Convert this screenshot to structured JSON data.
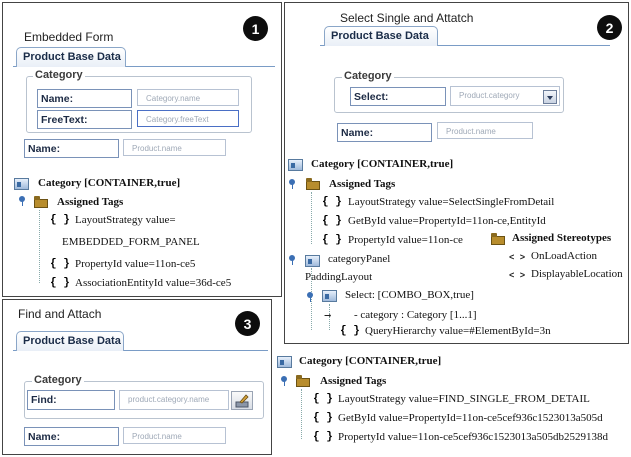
{
  "panels": [
    {
      "number": "1",
      "title": "Embedded Form",
      "tab": "Product Base Data",
      "group_label": "Category",
      "fields": [
        {
          "label": "Name:",
          "placeholder": "Category.name"
        },
        {
          "label": "FreeText:",
          "placeholder": "Category.freeText"
        }
      ],
      "outer_field": {
        "label": "Name:",
        "placeholder": "Product.name"
      },
      "tree": {
        "root": "Category [CONTAINER,true]",
        "tags_label": "Assigned Tags",
        "items": [
          "LayoutStrategy value=",
          "EMBEDDED_FORM_PANEL",
          "PropertyId value=11on-ce5",
          "AssociationEntityId value=36d-ce5"
        ]
      }
    },
    {
      "number": "2",
      "title": "Select Single and Attatch",
      "tab": "Product Base Data",
      "group_label": "Category",
      "fields": [
        {
          "label": "Select:",
          "placeholder": "Product.category"
        }
      ],
      "outer_field": {
        "label": "Name:",
        "placeholder": "Product.name"
      },
      "tree": {
        "root": "Category [CONTAINER,true]",
        "tags_label": "Assigned Tags",
        "items": [
          "LayoutStrategy value=SelectSingleFromDetail",
          "GetById value=PropertyId=11on-ce,EntityId",
          "PropertyId value=11on-ce"
        ],
        "stereotypes_label": "Assigned Stereotypes",
        "stereotypes": [
          "OnLoadAction",
          "DisplayableLocation"
        ],
        "panel_node": "categoryPanel",
        "padding_layout": "PaddingLayout",
        "select_node": "Select: [COMBO_BOX,true]",
        "select_children": [
          "- category : Category [1...1]",
          "QueryHierarchy value=#ElementById=3n"
        ]
      }
    },
    {
      "number": "3",
      "title": "Find and Attach",
      "tab": "Product Base Data",
      "group_label": "Category",
      "fields": [
        {
          "label": "Find:",
          "placeholder": "product.category.name"
        }
      ],
      "outer_field": {
        "label": "Name:",
        "placeholder": "Product.name"
      },
      "tree": {
        "root": "Category [CONTAINER,true]",
        "tags_label": "Assigned Tags",
        "items": [
          "LayoutStrategy value=FIND_SINGLE_FROM_DETAIL",
          "GetById value=PropertyId=11on-ce5cef936c1523013a505d",
          "PropertyId value=11on-ce5cef936c1523013a505db2529138d"
        ]
      }
    }
  ],
  "icons": {
    "container": "container-icon",
    "tags": "tag-folder-icon",
    "tagged_value": "braces-icon",
    "stereotype": "angle-brackets-icon",
    "expand": "tree-pin-icon",
    "picker": "picker-icon"
  },
  "colors": {
    "tab_text": "#1a2c48",
    "label_border": "#7a92b8",
    "placeholder": "#9fa9b7",
    "badge": "#0d0d0d"
  }
}
